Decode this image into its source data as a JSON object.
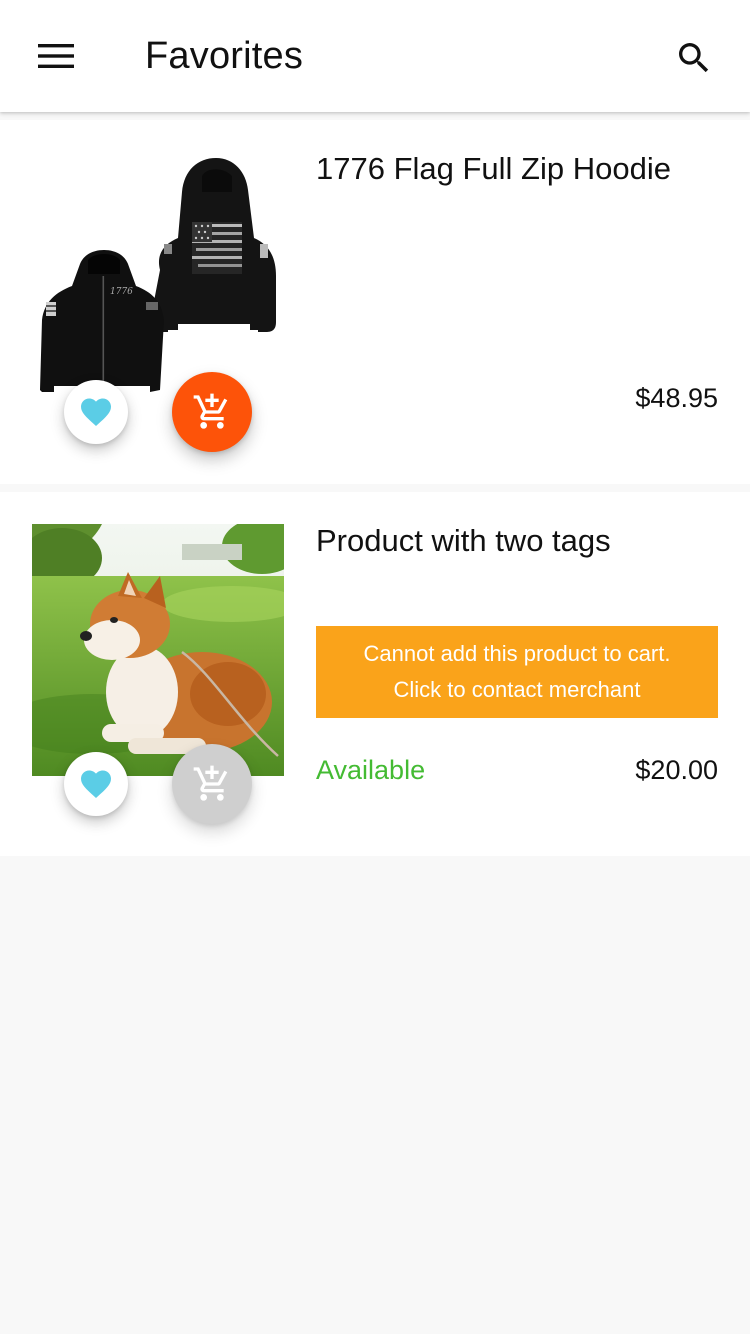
{
  "header": {
    "title": "Favorites",
    "menu_icon": "hamburger-menu-icon",
    "search_icon": "search-icon"
  },
  "products": [
    {
      "name": "1776 Flag Full Zip Hoodie",
      "price": "$48.95",
      "favorite": true,
      "can_add_to_cart": true,
      "image_icon": "black-hoodie-image"
    },
    {
      "name": "Product with two tags",
      "price": "$20.00",
      "availability": "Available",
      "favorite": true,
      "can_add_to_cart": false,
      "notice_line1": "Cannot add this product to cart.",
      "notice_line2": "Click to contact merchant",
      "image_icon": "dog-photo-image"
    }
  ],
  "colors": {
    "accent_orange": "#fd5309",
    "heart_blue": "#5bcde6",
    "notice_amber": "#faa31a",
    "available_green": "#44bb33",
    "disabled_gray": "#cfcfcf",
    "background": "#f8f8f8"
  }
}
